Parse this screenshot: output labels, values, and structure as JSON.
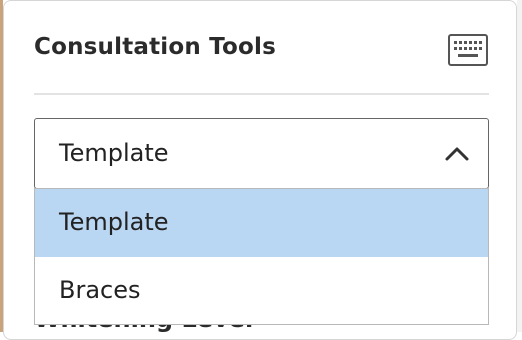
{
  "panel": {
    "title": "Consultation Tools",
    "keyboard_icon": "keyboard-icon"
  },
  "select": {
    "value": "Template",
    "chevron_icon": "chevron-up-icon",
    "options": [
      {
        "label": "Template",
        "selected": true
      },
      {
        "label": "Braces",
        "selected": false
      }
    ]
  },
  "partially_hidden_label": "Whitening Level",
  "colors": {
    "selected_option": "#b9d6f2",
    "border": "#666666",
    "text": "#222222"
  }
}
